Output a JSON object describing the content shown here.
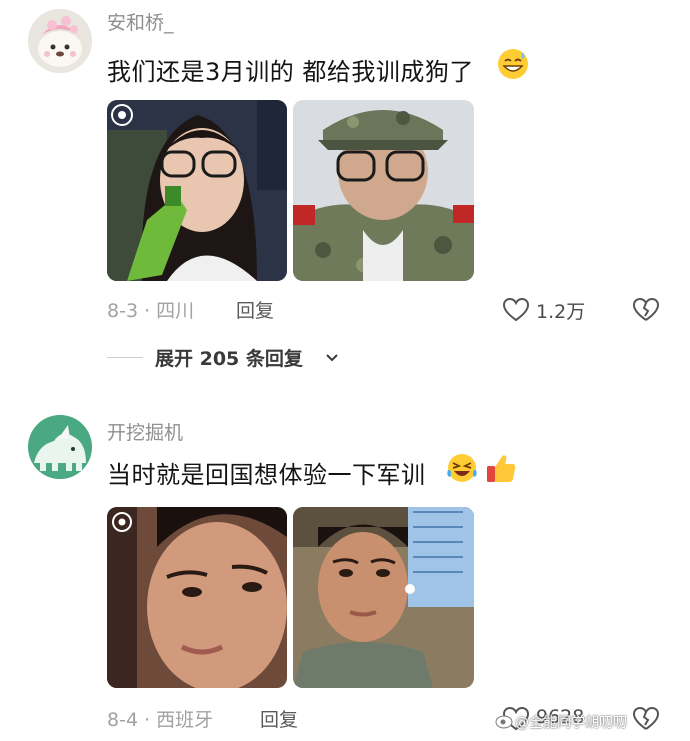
{
  "comments": [
    {
      "username": "安和桥_",
      "text": "我们还是3月训的 都给我训成狗了",
      "emoji": "grinning-sweat-emoji",
      "meta": "8-3 · 四川",
      "reply": "回复",
      "likes": "1.2万",
      "expand": "展开 205 条回复"
    },
    {
      "username": "开挖掘机",
      "text": "当时就是回国想体验一下军训",
      "emojis": [
        "rolling-laughing-emoji",
        "thumbs-up-emoji"
      ],
      "meta": "8-4 · 西班牙",
      "reply": "回复",
      "likes": "9628"
    }
  ],
  "watermark": "@全能同学胡叨叨",
  "colors": {
    "meta": "#a2a2a2",
    "username": "#8f8f8f",
    "text": "#141414"
  }
}
